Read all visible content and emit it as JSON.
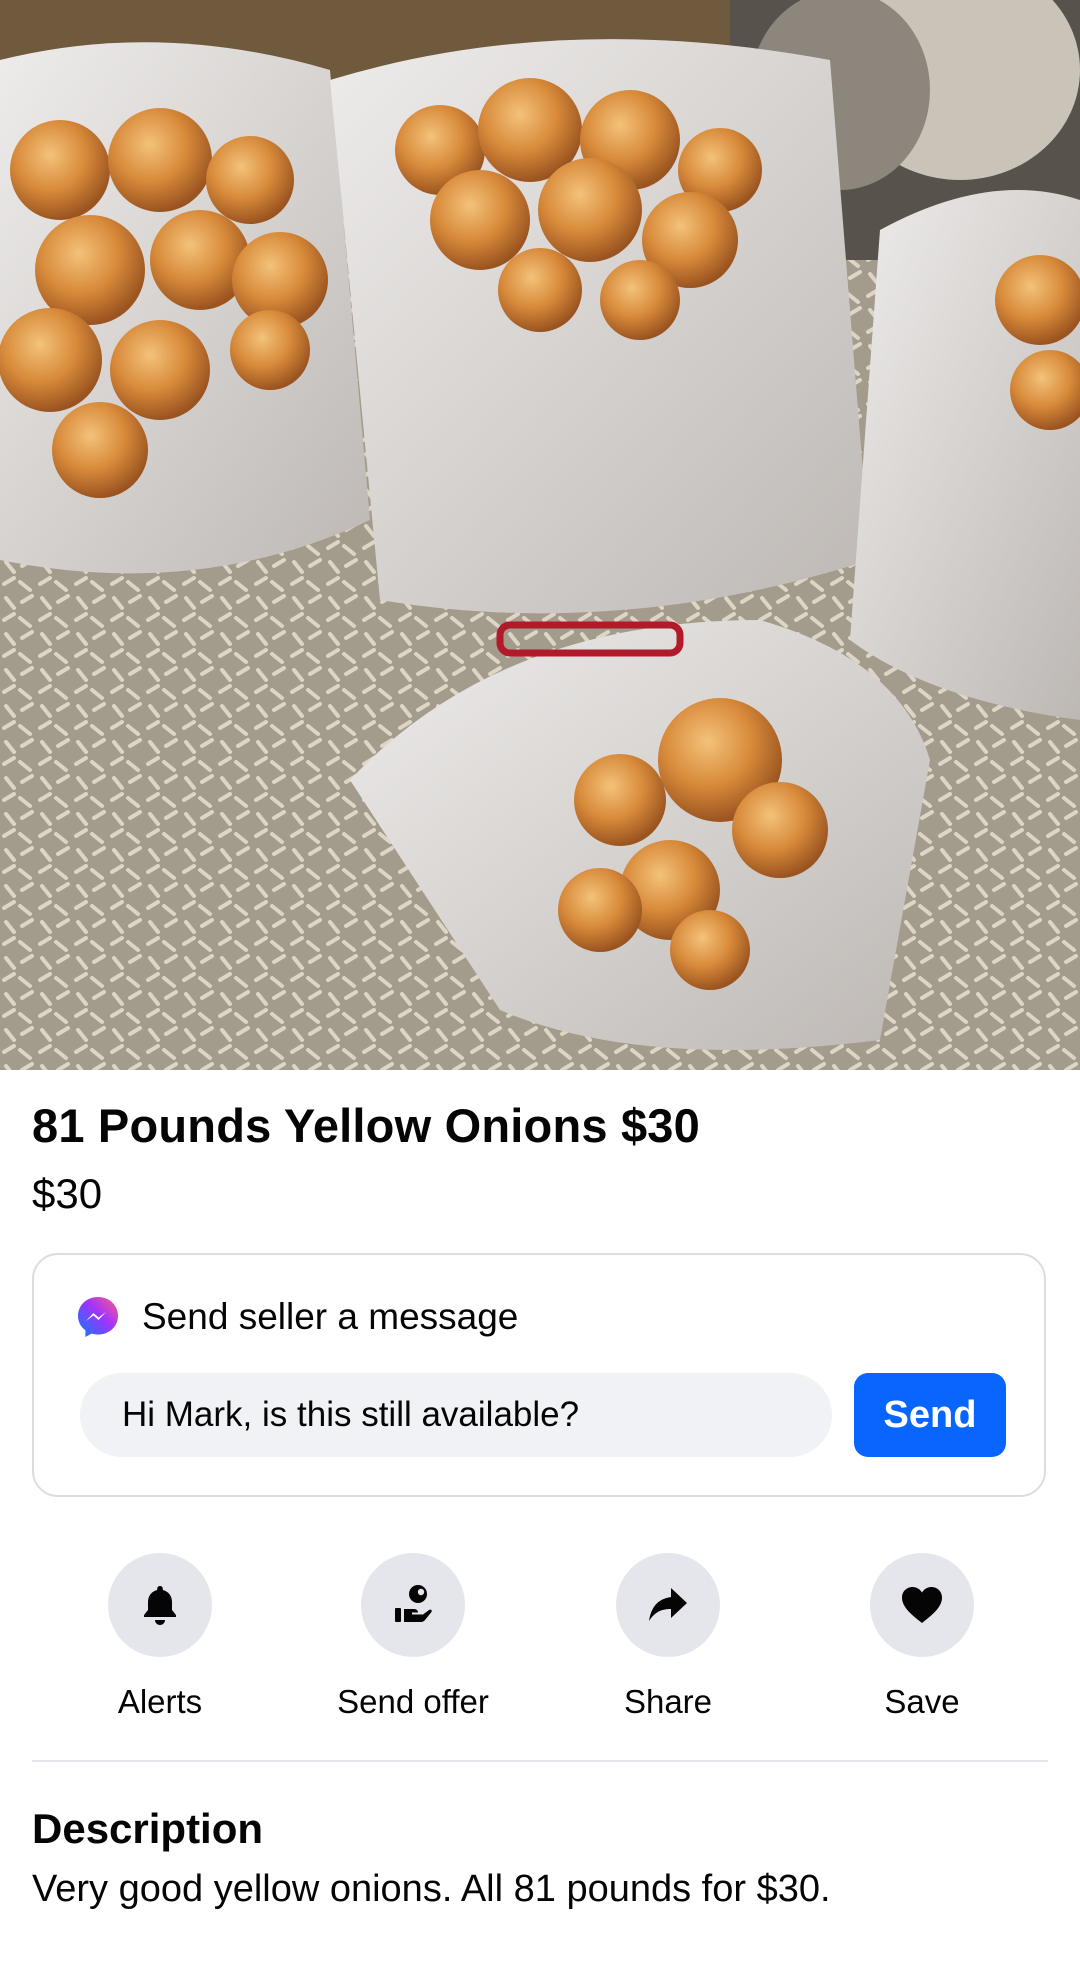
{
  "listing": {
    "title": "81 Pounds Yellow Onions $30",
    "price": "$30"
  },
  "message_card": {
    "heading": "Send seller a message",
    "input_value": "Hi Mark, is this still available?",
    "send_label": "Send",
    "icon": "messenger-icon"
  },
  "actions": [
    {
      "label": "Alerts",
      "icon": "bell-icon"
    },
    {
      "label": "Send offer",
      "icon": "hand-offer-icon"
    },
    {
      "label": "Share",
      "icon": "share-arrow-icon"
    },
    {
      "label": "Save",
      "icon": "heart-icon"
    }
  ],
  "description": {
    "heading": "Description",
    "text": "Very good yellow onions. All 81 pounds for $30."
  },
  "colors": {
    "accent": "#0866ff",
    "button_gray": "#e4e6eb",
    "input_bg": "#f0f2f5",
    "border": "#dadde1"
  }
}
